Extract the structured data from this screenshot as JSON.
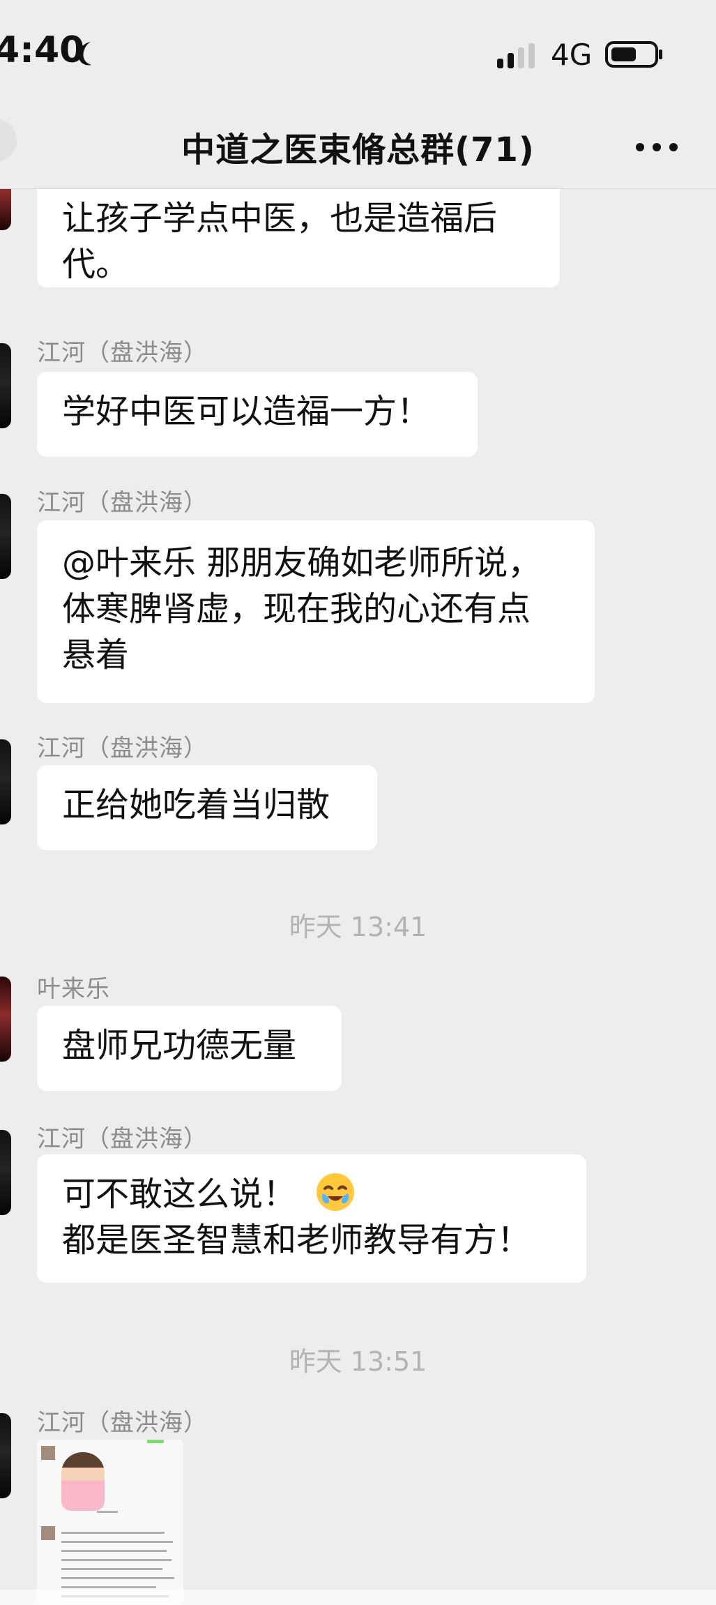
{
  "status_bar": {
    "time": "4:40",
    "network": "4G"
  },
  "header": {
    "title": "中道之医束脩总群(71)"
  },
  "messages": [
    {
      "text": "让孩子学点中医，也是造福后\n代。"
    },
    {
      "sender": "江河（盘洪海）",
      "text": "学好中医可以造福一方！"
    },
    {
      "sender": "江河（盘洪海）",
      "text": "@叶来乐 那朋友确如老师所说，\n体寒脾肾虚，现在我的心还有点\n悬着"
    },
    {
      "sender": "江河（盘洪海）",
      "text": "正给她吃着当归散"
    },
    {
      "timestamp": "昨天 13:41"
    },
    {
      "sender": "叶来乐",
      "text": "盘师兄功德无量"
    },
    {
      "sender": "江河（盘洪海）",
      "text_line1": "可不敢这么说！",
      "text_line2": "都是医圣智慧和老师教导有方！",
      "emoji": "face-with-hand-over-mouth-crying-emoji"
    },
    {
      "timestamp": "昨天 13:51"
    },
    {
      "sender": "江河（盘洪海）",
      "image": "chat-screenshot-thumbnail"
    }
  ],
  "colors": {
    "background": "#ededed",
    "bubble": "#ffffff",
    "secondary_text": "#8c8c8c",
    "timestamp_text": "#b3b3b3"
  },
  "icons": {
    "moon": "moon-icon",
    "signal": "signal-strength-icon",
    "battery": "battery-icon",
    "more": "more-options-icon"
  }
}
